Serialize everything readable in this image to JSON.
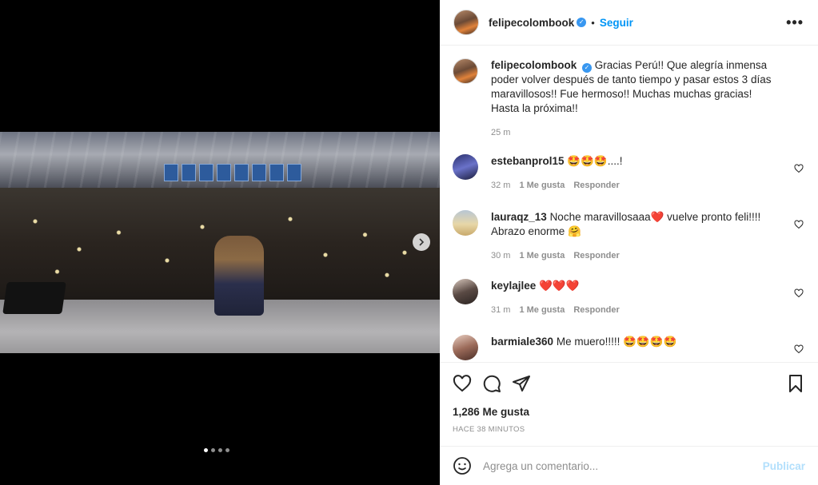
{
  "post": {
    "username": "felipecolombook",
    "follow_label": "Seguir",
    "separator": "•",
    "more_label": "•••"
  },
  "caption": {
    "username": "felipecolombook",
    "text": "Gracias Perú!! Que alegría inmensa poder volver después de tanto tiempo y pasar estos 3 días maravillosos!! Fue hermoso!! Muchas muchas gracias! Hasta la próxima!!",
    "time": "25 m"
  },
  "comments": [
    {
      "username": "estebanprol15",
      "text": "🤩🤩🤩....!",
      "time": "32 m",
      "likes": "1 Me gusta",
      "reply": "Responder"
    },
    {
      "username": "lauraqz_13",
      "text": "Noche maravillosaaa❤️ vuelve pronto feli!!!! Abrazo enorme 🤗",
      "time": "30 m",
      "likes": "1 Me gusta",
      "reply": "Responder"
    },
    {
      "username": "keylajlee",
      "text": "❤️❤️❤️",
      "time": "31 m",
      "likes": "1 Me gusta",
      "reply": "Responder"
    },
    {
      "username": "barmiale360",
      "text": "Me muero!!!!! 🤩🤩🤩🤩",
      "time": "",
      "likes": "",
      "reply": ""
    }
  ],
  "stats": {
    "likes": "1,286 Me gusta",
    "timestamp": "HACE 38 MINUTOS"
  },
  "composer": {
    "placeholder": "Agrega un comentario...",
    "post_label": "Publicar"
  },
  "carousel": {
    "dot_count": 4,
    "active_index": 0
  },
  "colors": {
    "accent": "#0095f6",
    "verified": "#3897f0",
    "muted": "#8e8e8e",
    "post_disabled": "#b2dffc"
  },
  "icons": [
    "verified-badge-icon",
    "more-options-icon",
    "heart-icon",
    "comment-icon",
    "share-icon",
    "bookmark-icon",
    "emoji-icon",
    "chevron-right-icon"
  ]
}
